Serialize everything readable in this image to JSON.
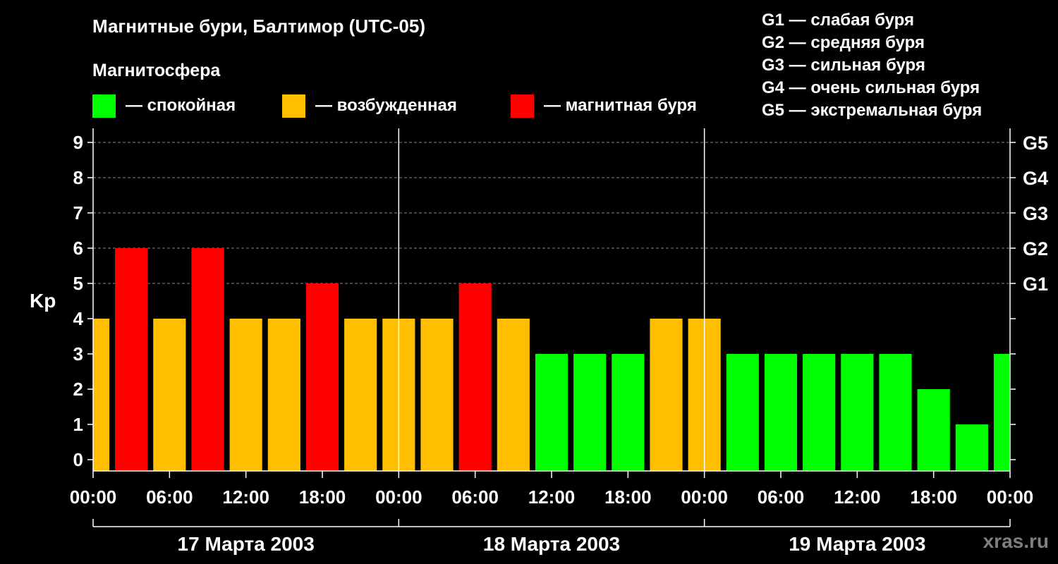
{
  "chart_data": {
    "type": "bar",
    "title": "Магнитные бури, Балтимор (UTC-05)",
    "ylabel": "Kp",
    "ylim": [
      0,
      9
    ],
    "yticks": [
      "0",
      "1",
      "2",
      "3",
      "4",
      "5",
      "6",
      "7",
      "8",
      "9"
    ],
    "right_ticks": [
      {
        "kp": 5,
        "label": "G1"
      },
      {
        "kp": 6,
        "label": "G2"
      },
      {
        "kp": 7,
        "label": "G3"
      },
      {
        "kp": 8,
        "label": "G4"
      },
      {
        "kp": 9,
        "label": "G5"
      }
    ],
    "xticks": [
      "00:00",
      "06:00",
      "12:00",
      "18:00",
      "00:00",
      "06:00",
      "12:00",
      "18:00",
      "00:00",
      "06:00",
      "12:00",
      "18:00",
      "00:00"
    ],
    "days": [
      "17 Марта 2003",
      "18 Марта 2003",
      "19 Марта 2003"
    ],
    "hours_total": 72,
    "bar_width_hours": 3,
    "start_hour": -1.5,
    "values": [
      4,
      6,
      4,
      6,
      4,
      4,
      5,
      4,
      4,
      4,
      5,
      4,
      3,
      3,
      3,
      4,
      4,
      3,
      3,
      3,
      3,
      3,
      2,
      1,
      3
    ],
    "color_rule": {
      "quiet_max": 3,
      "active_value": 4,
      "storm_min": 5
    },
    "colors": {
      "quiet": "#00ff00",
      "active": "#ffbf00",
      "storm": "#ff0000"
    },
    "grid": "dashed horizontal lines at 5–9",
    "legend": {
      "heading": "Магнитосфера",
      "items": [
        {
          "key": "quiet",
          "label": "— спокойная"
        },
        {
          "key": "active",
          "label": "— возбужденная"
        },
        {
          "key": "storm",
          "label": "— магнитная буря"
        }
      ]
    },
    "storm_scale": [
      "G1 — слабая буря",
      "G2 — средняя буря",
      "G3 — сильная буря",
      "G4 — очень сильная буря",
      "G5 — экстремальная буря"
    ]
  },
  "watermark": "xras.ru"
}
